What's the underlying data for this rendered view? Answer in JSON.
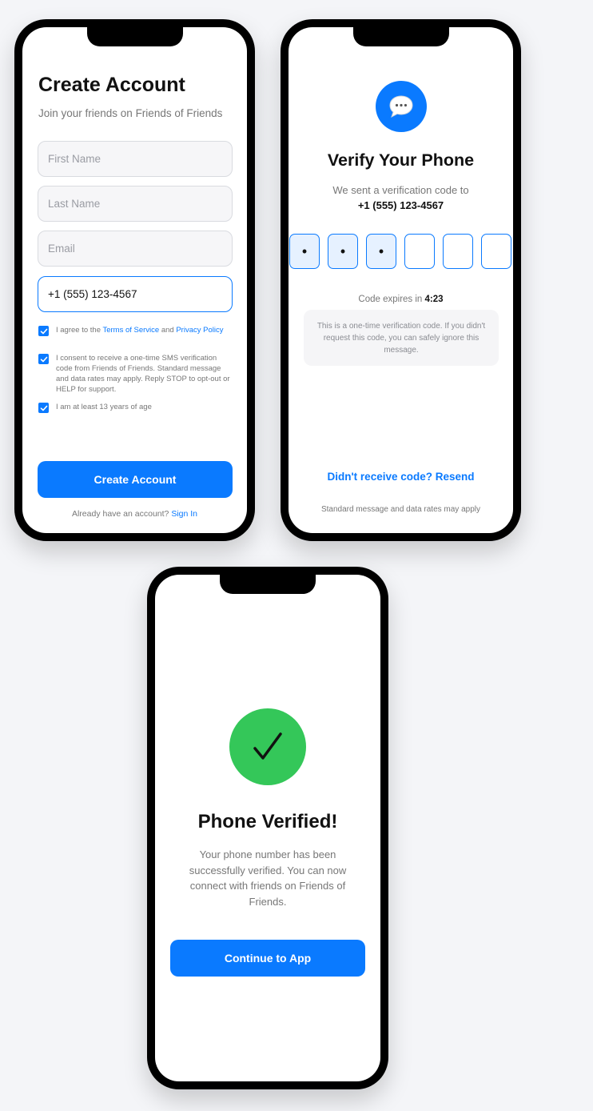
{
  "colors": {
    "accent": "#0a7aff",
    "success": "#34c759",
    "muted_text": "#777777",
    "field_bg": "#f6f6f8",
    "page_bg": "#f4f5f8"
  },
  "signup": {
    "title": "Create Account",
    "subtitle": "Join your friends on Friends of Friends",
    "fields": {
      "first_name": {
        "placeholder": "First Name",
        "value": ""
      },
      "last_name": {
        "placeholder": "Last Name",
        "value": ""
      },
      "email": {
        "placeholder": "Email",
        "value": ""
      },
      "phone": {
        "value": "+1 (555) 123-4567"
      }
    },
    "terms": {
      "prefix": "I agree to the ",
      "tos": "Terms of Service",
      "and": " and ",
      "privacy": "Privacy Policy",
      "checked": true
    },
    "sms_consent": {
      "text": "I consent to receive a one-time SMS verification code from Friends of Friends. Standard message and data rates may apply. Reply STOP to opt-out or HELP for support.",
      "checked": true
    },
    "age": {
      "text": "I am at least 13 years of age",
      "checked": true
    },
    "submit_label": "Create Account",
    "footer_text": "Already have an account? ",
    "sign_in_label": "Sign In"
  },
  "verify": {
    "icon": "message-bubble-icon",
    "title": "Verify Your Phone",
    "sent_text": "We sent a verification code to",
    "phone": "+1 (555) 123-4567",
    "code_digits": [
      "•",
      "•",
      "•",
      "",
      "",
      ""
    ],
    "expires_label": "Code expires in ",
    "expires_time": "4:23",
    "notice": "This is a one-time verification code. If you didn't request this code, you can safely ignore this message.",
    "resend_label": "Didn't receive code? Resend",
    "footer": "Standard message and data rates may apply"
  },
  "verified": {
    "icon": "checkmark-icon",
    "title": "Phone Verified!",
    "message": "Your phone number has been successfully verified. You can now connect with friends on Friends of Friends.",
    "continue_label": "Continue to App"
  }
}
